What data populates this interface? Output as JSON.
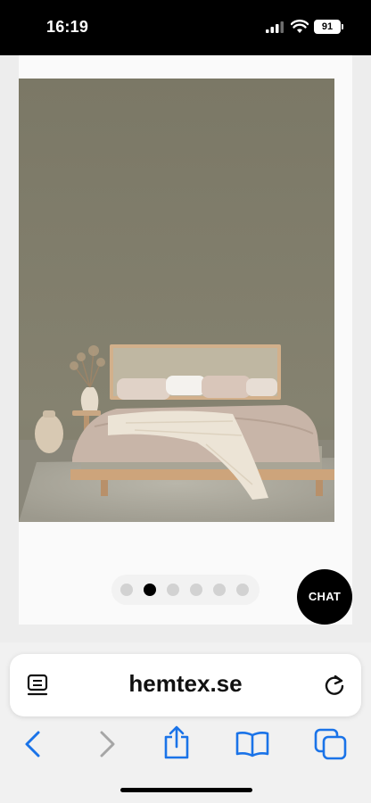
{
  "status_bar": {
    "time": "16:19",
    "battery": "91"
  },
  "carousel": {
    "slide_count": 6,
    "active_index": 1
  },
  "chat": {
    "label": "CHAT"
  },
  "browser": {
    "domain": "hemtex.se"
  },
  "icons": {
    "reader": "reader-icon",
    "reload": "reload-icon",
    "back": "back-icon",
    "forward": "forward-icon",
    "share": "share-icon",
    "bookmarks": "bookmarks-icon",
    "tabs": "tabs-icon"
  },
  "colors": {
    "accent": "#1a73e8",
    "wall": "#7d7a67"
  }
}
